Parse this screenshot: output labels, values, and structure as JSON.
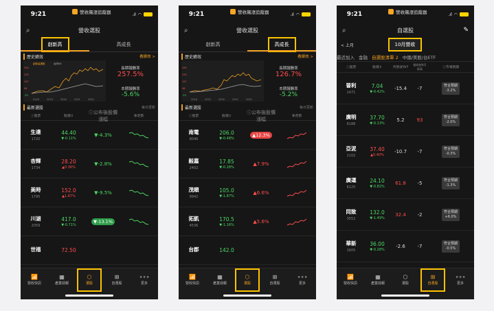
{
  "status": {
    "time": "9:21",
    "app_name": "營收飆漲追蹤器",
    "signal": ".ıl"
  },
  "screen1": {
    "title": "營收選股",
    "tabs": [
      "創新高",
      "高成長"
    ],
    "active": 0,
    "history_label": "歷史績效",
    "see_perf": "看績效 >",
    "legend_a": "創新高選股",
    "legend_b": "台灣50",
    "y_ticks": [
      "335",
      "235",
      "147",
      "98",
      "-33"
    ],
    "x_ticks": [
      "2018",
      "2019",
      "2020",
      "2021",
      "2022"
    ],
    "long_label": "長期報酬率",
    "long_value": "257.5%",
    "recent_label": "本期報酬率",
    "recent_value": "-5.6%",
    "latest_label": "最新選股",
    "updated": "每日更新",
    "cols": [
      "股票",
      "股價",
      "公布後股價漲幅",
      "季走勢"
    ],
    "rows": [
      {
        "name": "生達",
        "code": "1720",
        "price": "44.40",
        "chg": "▼-0.11%",
        "dir": "dn",
        "gain": "▼-4.3%",
        "gdir": "dn",
        "pill": false
      },
      {
        "name": "杏輝",
        "code": "1734",
        "price": "28.20",
        "chg": "▲0.36%",
        "dir": "up",
        "gain": "▼-2.8%",
        "gdir": "dn",
        "pill": false
      },
      {
        "name": "美時",
        "code": "1795",
        "price": "152.0",
        "chg": "▲1.67%",
        "dir": "up",
        "gain": "▼-9.5%",
        "gdir": "dn",
        "pill": false
      },
      {
        "name": "川湖",
        "code": "2059",
        "price": "417.0",
        "chg": "▼-0.71%",
        "dir": "dn",
        "gain": "▼-13.1%",
        "gdir": "g",
        "pill": true
      },
      {
        "name": "世禧",
        "code": "",
        "price": "72.50",
        "chg": "",
        "dir": "up",
        "gain": "",
        "gdir": "dn",
        "pill": false
      }
    ]
  },
  "screen2": {
    "title": "營收選股",
    "tabs": [
      "創新高",
      "高成長"
    ],
    "active": 1,
    "history_label": "歷史績效",
    "see_perf": "看績效 >",
    "y_ticks": [
      "335",
      "235",
      "147",
      "98",
      "-33"
    ],
    "x_ticks": [
      "2018",
      "2019",
      "2020",
      "2021",
      "2022"
    ],
    "long_label": "長期報酬率",
    "long_value": "126.7%",
    "recent_label": "本期報酬率",
    "recent_value": "-5.2%",
    "latest_label": "最新選股",
    "updated": "每日更新",
    "cols": [
      "股票",
      "股價",
      "公布後股價漲幅",
      "季走勢"
    ],
    "rows": [
      {
        "name": "南電",
        "code": "8046",
        "price": "206.0",
        "chg": "▼-0.48%",
        "dir": "dn",
        "gain": "▲12.3%",
        "gdir": "r",
        "pill": true
      },
      {
        "name": "毅嘉",
        "code": "2402",
        "price": "17.85",
        "chg": "▼-0.28%",
        "dir": "dn",
        "gain": "▲7.9%",
        "gdir": "up",
        "pill": false
      },
      {
        "name": "茂順",
        "code": "9942",
        "price": "105.0",
        "chg": "▼-1.87%",
        "dir": "dn",
        "gain": "▲6.6%",
        "gdir": "up",
        "pill": false
      },
      {
        "name": "拓凱",
        "code": "4536",
        "price": "170.5",
        "chg": "▼-1.16%",
        "dir": "dn",
        "gain": "▲5.6%",
        "gdir": "up",
        "pill": false
      },
      {
        "name": "台郡",
        "code": "",
        "price": "142.0",
        "chg": "",
        "dir": "dn",
        "gain": "",
        "gdir": "up",
        "pill": false
      }
    ]
  },
  "screen3": {
    "title": "自選股",
    "back": "< 上月",
    "month": "10月營收",
    "chips": [
      "最近加入",
      "金融",
      "自選股清單 2",
      "中國/美股/台ETF"
    ],
    "cols": [
      "股票",
      "股價",
      "月營收YoY",
      "營收創N月新高",
      "市場預期"
    ],
    "rows": [
      {
        "name": "晉利",
        "code": "1471",
        "price": "7.04",
        "chg": "▼-0.42%",
        "dir": "dn",
        "yoy": "-15.4",
        "ydir": "wh",
        "nm": "-7",
        "ndir": "wh",
        "tgt1": "符合預期",
        "tgt2": "-3.2%"
      },
      {
        "name": "廣明",
        "code": "6188",
        "price": "37.70",
        "chg": "▼-0.13%",
        "dir": "dn",
        "yoy": "5.2",
        "ydir": "wh",
        "nm": "93",
        "ndir": "up",
        "tgt1": "符合預期",
        "tgt2": "-2.0%"
      },
      {
        "name": "亞泥",
        "code": "1102",
        "price": "37.40",
        "chg": "▲0.40%",
        "dir": "up",
        "yoy": "-10.7",
        "ydir": "wh",
        "nm": "-7",
        "ndir": "wh",
        "tgt1": "符合預期",
        "tgt2": "-0.3%"
      },
      {
        "name": "廣運",
        "code": "6125",
        "price": "24.10",
        "chg": "▼-0.82%",
        "dir": "dn",
        "yoy": "61.8",
        "ydir": "up",
        "nm": "-5",
        "ndir": "wh",
        "tgt1": "符合預期",
        "tgt2": "-1.3%"
      },
      {
        "name": "同致",
        "code": "3552",
        "price": "132.0",
        "chg": "▼-1.49%",
        "dir": "dn",
        "yoy": "32.4",
        "ydir": "up",
        "nm": "-2",
        "ndir": "wh",
        "tgt1": "符合預期",
        "tgt2": "+6.0%"
      },
      {
        "name": "華新",
        "code": "1605",
        "price": "36.00",
        "chg": "▼-0.28%",
        "dir": "dn",
        "yoy": "-2.6",
        "ydir": "wh",
        "nm": "-7",
        "ndir": "wh",
        "tgt1": "符合預期",
        "tgt2": "-0.5%"
      }
    ]
  },
  "nav": [
    "營收快訊",
    "產業週報",
    "選股",
    "自選股",
    "更多"
  ],
  "colors": {
    "accent": "#f0a020",
    "up": "#ff4d4d",
    "down": "#4cd964",
    "highlight": "#ffc400"
  }
}
